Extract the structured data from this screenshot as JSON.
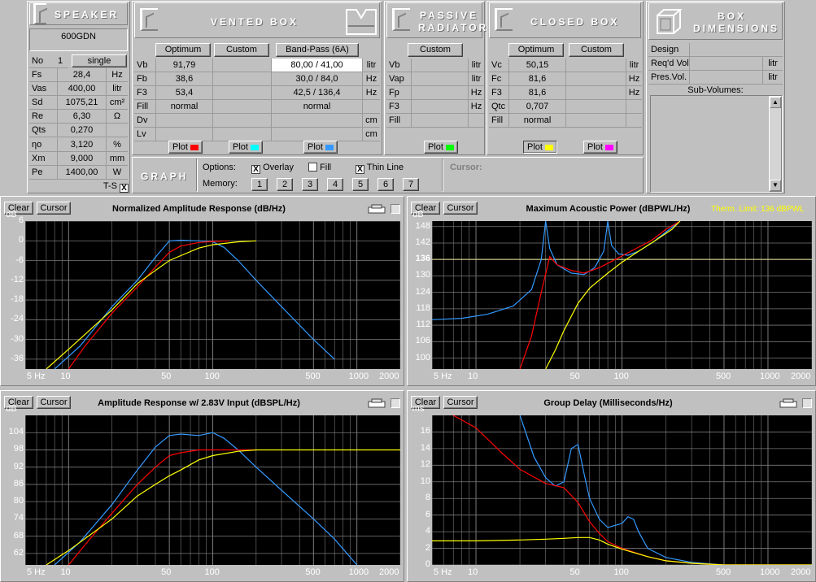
{
  "speaker": {
    "title": "SPEAKER",
    "name": "600GDN",
    "no_label": "No",
    "no_value": "1",
    "mode": "single",
    "params": [
      {
        "label": "Fs",
        "value": "28,4",
        "unit": "Hz"
      },
      {
        "label": "Vas",
        "value": "400,00",
        "unit": "litr"
      },
      {
        "label": "Sd",
        "value": "1075,21",
        "unit": "cm²"
      },
      {
        "label": "Re",
        "value": "6,30",
        "unit": "Ω"
      },
      {
        "label": "Qts",
        "value": "0,270",
        "unit": ""
      },
      {
        "label": "ηo",
        "value": "3,120",
        "unit": "%"
      },
      {
        "label": "Xm",
        "value": "9,000",
        "unit": "mm"
      },
      {
        "label": "Pe",
        "value": "1400,00",
        "unit": "W"
      }
    ],
    "ts_label": "T-S",
    "ts_checked": "X"
  },
  "vented": {
    "title": "VENTED BOX",
    "btn_optimum": "Optimum",
    "btn_custom": "Custom",
    "btn_bandpass": "Band-Pass (6A)",
    "rows": [
      {
        "label": "Vb",
        "optimum": "91,79",
        "custom": "",
        "bandpass": "80,00 / 41,00",
        "unit": "litr"
      },
      {
        "label": "Fb",
        "optimum": "38,6",
        "custom": "",
        "bandpass": "30,0 / 84,0",
        "unit": "Hz"
      },
      {
        "label": "F3",
        "optimum": "53,4",
        "custom": "",
        "bandpass": "42,5 / 136,4",
        "unit": "Hz"
      },
      {
        "label": "Fill",
        "optimum": "normal",
        "custom": "",
        "bandpass": "normal",
        "unit": ""
      },
      {
        "label": "Dv",
        "optimum": "",
        "custom": "",
        "bandpass": "",
        "unit": "cm"
      },
      {
        "label": "Lv",
        "optimum": "",
        "custom": "",
        "bandpass": "",
        "unit": "cm"
      }
    ],
    "plot_label": "Plot"
  },
  "passive": {
    "title_1": "PASSIVE",
    "title_2": "RADIATOR",
    "btn_custom": "Custom",
    "rows": [
      {
        "label": "Vb",
        "unit": "litr"
      },
      {
        "label": "Vap",
        "unit": "litr"
      },
      {
        "label": "Fp",
        "unit": "Hz"
      },
      {
        "label": "F3",
        "unit": "Hz"
      },
      {
        "label": "Fill",
        "unit": ""
      }
    ],
    "plot_label": "Plot"
  },
  "closed": {
    "title": "CLOSED BOX",
    "btn_optimum": "Optimum",
    "btn_custom": "Custom",
    "rows": [
      {
        "label": "Vc",
        "optimum": "50,15",
        "unit": "litr"
      },
      {
        "label": "Fc",
        "optimum": "81,6",
        "unit": "Hz"
      },
      {
        "label": "F3",
        "optimum": "81,6",
        "unit": "Hz"
      },
      {
        "label": "Qtc",
        "optimum": "0,707",
        "unit": ""
      },
      {
        "label": "Fill",
        "optimum": "normal",
        "unit": ""
      }
    ],
    "plot_label": "Plot"
  },
  "dims": {
    "title_1": "BOX",
    "title_2": "DIMENSIONS",
    "design": "Design",
    "reqd": "Req'd Vol.",
    "pres": "Pres.Vol.",
    "unit": "litr",
    "subvol": "Sub-Volumes:"
  },
  "graph": {
    "title": "GRAPH",
    "options_label": "Options:",
    "overlay": "Overlay",
    "fill": "Fill",
    "thinline": "Thin Line",
    "overlay_checked": "X",
    "fill_checked": "",
    "thinline_checked": "X",
    "memory_label": "Memory:",
    "memory": [
      "1",
      "2",
      "3",
      "4",
      "5",
      "6",
      "7"
    ],
    "cursor_label": "Cursor:"
  },
  "colors": {
    "red": "#ff0000",
    "cyan": "#00ffff",
    "blue": "#3399ff",
    "green": "#00ff00",
    "yellow": "#ffff00",
    "magenta": "#ff00ff",
    "grid": "#7a7a7a",
    "hline": "#e8e89a"
  },
  "panels": {
    "p1": {
      "title": "Normalized Amplitude Response (dB/Hz)",
      "clear": "Clear",
      "cursor": "Cursor",
      "unit": "dB"
    },
    "p2": {
      "title": "Maximum Acoustic Power (dBPWL/Hz)",
      "clear": "Clear",
      "cursor": "Cursor",
      "unit": "dB",
      "note": "Therm. Limit: 136 dBPWL"
    },
    "p3": {
      "title": "Amplitude Response w/ 2.83V Input (dBSPL/Hz)",
      "clear": "Clear",
      "cursor": "Cursor",
      "unit": "dB"
    },
    "p4": {
      "title": "Group Delay (Milliseconds/Hz)",
      "clear": "Clear",
      "cursor": "Cursor",
      "unit": "ms"
    }
  },
  "chart_data": [
    {
      "type": "line",
      "title": "Normalized Amplitude Response (dB/Hz)",
      "ylabel": "dB",
      "xscale": "log",
      "xlim": [
        5,
        2000
      ],
      "ylim": [
        -39,
        6
      ],
      "xticks": [
        "5 Hz",
        "10",
        "50",
        "100",
        "500",
        "1000",
        "2000"
      ],
      "yticks": [
        "6",
        "0",
        "-6",
        "-12",
        "-18",
        "-24",
        "-30",
        "-36"
      ],
      "series": [
        {
          "color": "blue",
          "x": [
            8,
            12,
            20,
            30,
            40,
            50,
            60,
            80,
            100,
            120,
            150,
            200,
            300,
            500,
            700
          ],
          "y": [
            -39,
            -32,
            -20,
            -12,
            -5,
            0,
            0.2,
            0,
            -0.3,
            -2,
            -6,
            -12,
            -20,
            -30,
            -36
          ]
        },
        {
          "color": "red",
          "x": [
            10,
            13,
            20,
            30,
            40,
            50,
            60,
            80,
            100,
            130
          ],
          "y": [
            -39,
            -32,
            -22,
            -14,
            -8,
            -3.5,
            -1.6,
            -0.5,
            -0.2,
            0
          ]
        },
        {
          "color": "yellow",
          "x": [
            7,
            10,
            20,
            30,
            40,
            50,
            60,
            80,
            100,
            150,
            200
          ],
          "y": [
            -39,
            -33,
            -21,
            -13,
            -9,
            -6,
            -4.5,
            -2.2,
            -1.2,
            -0.3,
            0
          ]
        }
      ]
    },
    {
      "type": "line",
      "title": "Maximum Acoustic Power (dBPWL/Hz)",
      "ylabel": "dB",
      "xscale": "log",
      "xlim": [
        5,
        2000
      ],
      "ylim": [
        96,
        150
      ],
      "xticks": [
        "5 Hz",
        "10",
        "50",
        "100",
        "500",
        "1000",
        "2000"
      ],
      "yticks": [
        "148",
        "142",
        "136",
        "130",
        "124",
        "118",
        "112",
        "106",
        "100"
      ],
      "reference": 136,
      "series": [
        {
          "color": "blue",
          "x": [
            5,
            8,
            12,
            18,
            24,
            28,
            30,
            32,
            36,
            45,
            55,
            65,
            75,
            80,
            85,
            95,
            110,
            130,
            160,
            200,
            250
          ],
          "y": [
            114,
            114.5,
            116,
            119,
            125,
            136,
            150,
            140,
            134,
            131,
            130.5,
            133,
            139,
            150,
            141,
            138,
            137.5,
            139,
            142,
            146,
            150
          ]
        },
        {
          "color": "red",
          "x": [
            20,
            24,
            28,
            32,
            36,
            45,
            55,
            70,
            90,
            120,
            160,
            200,
            250
          ],
          "y": [
            96,
            108,
            124,
            137,
            134,
            132,
            131,
            133,
            136,
            139.5,
            143,
            147,
            150
          ]
        },
        {
          "color": "yellow",
          "x": [
            30,
            35,
            40,
            50,
            60,
            80,
            100,
            130,
            170,
            220,
            250
          ],
          "y": [
            96,
            103,
            110,
            120,
            125.5,
            131,
            135,
            139,
            143,
            147,
            150
          ]
        }
      ]
    },
    {
      "type": "line",
      "title": "Amplitude Response w/ 2.83V Input (dBSPL/Hz)",
      "ylabel": "dB",
      "xscale": "log",
      "xlim": [
        5,
        2000
      ],
      "ylim": [
        58,
        110
      ],
      "xticks": [
        "5 Hz",
        "10",
        "50",
        "100",
        "500",
        "1000",
        "2000"
      ],
      "yticks": [
        "104",
        "98",
        "92",
        "86",
        "80",
        "74",
        "68",
        "62"
      ],
      "series": [
        {
          "color": "blue",
          "x": [
            8,
            12,
            20,
            30,
            40,
            50,
            60,
            80,
            100,
            120,
            150,
            200,
            300,
            500,
            700,
            1000
          ],
          "y": [
            58,
            66,
            79,
            91,
            99,
            103,
            103.5,
            103,
            104,
            102,
            98,
            92,
            84,
            74,
            67,
            58
          ]
        },
        {
          "color": "red",
          "x": [
            10,
            13,
            20,
            30,
            40,
            50,
            60,
            80,
            100,
            130,
            200
          ],
          "y": [
            58,
            65,
            76,
            86,
            92,
            96,
            97,
            98,
            98,
            98,
            98
          ]
        },
        {
          "color": "yellow",
          "x": [
            7,
            10,
            20,
            30,
            40,
            50,
            60,
            80,
            100,
            150,
            200,
            2000
          ],
          "y": [
            58,
            63,
            74,
            82,
            86,
            89,
            91,
            94.5,
            96,
            97.5,
            98,
            98
          ]
        }
      ]
    },
    {
      "type": "line",
      "title": "Group Delay (Milliseconds/Hz)",
      "ylabel": "ms",
      "xscale": "log",
      "xlim": [
        5,
        2000
      ],
      "ylim": [
        0,
        18
      ],
      "xticks": [
        "5 Hz",
        "10",
        "50",
        "100",
        "500",
        "1000",
        "2000"
      ],
      "yticks": [
        "16",
        "14",
        "12",
        "10",
        "8",
        "6",
        "4",
        "2",
        "0"
      ],
      "series": [
        {
          "color": "blue",
          "x": [
            20,
            25,
            30,
            35,
            40,
            45,
            50,
            55,
            60,
            70,
            80,
            100,
            110,
            120,
            130,
            150,
            200,
            300,
            500,
            1000,
            2000
          ],
          "y": [
            18,
            13,
            10.5,
            9.5,
            10,
            14,
            14.5,
            11,
            8,
            5.5,
            4.5,
            5,
            5.8,
            5.5,
            4,
            2,
            0.9,
            0.3,
            0,
            0,
            0
          ]
        },
        {
          "color": "red",
          "x": [
            7,
            10,
            15,
            20,
            30,
            40,
            50,
            60,
            70,
            80,
            100,
            150,
            200,
            300,
            500,
            2000
          ],
          "y": [
            18,
            16.5,
            13.5,
            11.5,
            9.8,
            9.3,
            7.5,
            5.2,
            3.8,
            2.8,
            2,
            1,
            0.5,
            0.2,
            0,
            0
          ]
        },
        {
          "color": "yellow",
          "x": [
            5,
            10,
            20,
            30,
            40,
            50,
            60,
            70,
            80,
            100,
            150,
            200,
            300,
            500,
            2000
          ],
          "y": [
            2.9,
            2.9,
            3,
            3.1,
            3.2,
            3.3,
            3.3,
            3,
            2.5,
            1.9,
            1,
            0.5,
            0.2,
            0,
            0
          ]
        }
      ]
    }
  ]
}
